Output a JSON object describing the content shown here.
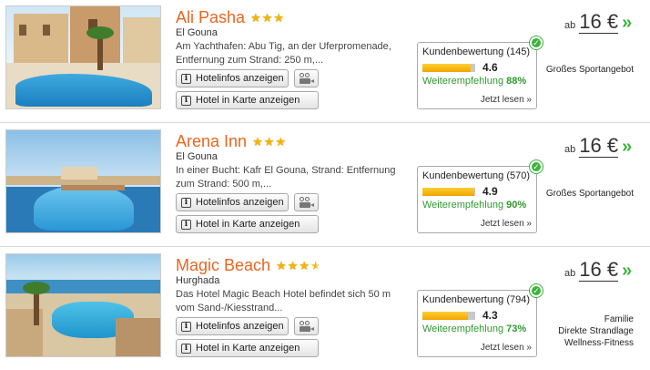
{
  "hotels": [
    {
      "name": "Ali Pasha",
      "stars": 3,
      "location": "El Gouna",
      "description": "Am Yachthafen: Abu Tig, an der Uferpromenade, Entfernung zum Strand: 250 m,...",
      "info_button": "Hotelinfos anzeigen",
      "map_button": "Hotel in Karte anzeigen",
      "rating_label": "Kundenbewertung (145)",
      "score": "4.6",
      "score_fraction": 0.92,
      "recommend_label": "Weiterempfehlung",
      "recommend_pct": "88%",
      "read_label": "Jetzt lesen »",
      "price_prefix": "ab",
      "price": "16 €",
      "go_icon": "»",
      "features": [
        "Großes Sportangebot"
      ]
    },
    {
      "name": "Arena Inn",
      "stars": 3,
      "location": "El Gouna",
      "description": "In einer Bucht: Kafr El Gouna, Strand: Entfernung zum Strand: 500 m,...",
      "info_button": "Hotelinfos anzeigen",
      "map_button": "Hotel in Karte anzeigen",
      "rating_label": "Kundenbewertung (570)",
      "score": "4.9",
      "score_fraction": 0.98,
      "recommend_label": "Weiterempfehlung",
      "recommend_pct": "90%",
      "read_label": "Jetzt lesen »",
      "price_prefix": "ab",
      "price": "16 €",
      "go_icon": "»",
      "features": [
        "Großes Sportangebot"
      ]
    },
    {
      "name": "Magic Beach",
      "stars": 3.5,
      "location": "Hurghada",
      "description": "Das Hotel Magic Beach Hotel befindet sich 50 m vom Sand-/Kiesstrand...",
      "info_button": "Hotelinfos anzeigen",
      "map_button": "Hotel in Karte anzeigen",
      "rating_label": "Kundenbewertung (794)",
      "score": "4.3",
      "score_fraction": 0.86,
      "recommend_label": "Weiterempfehlung",
      "recommend_pct": "73%",
      "read_label": "Jetzt lesen »",
      "price_prefix": "ab",
      "price": "16 €",
      "go_icon": "»",
      "features": [
        "Familie",
        "Direkte Strandlage",
        "Wellness-Fitness"
      ]
    }
  ],
  "colors": {
    "hotel_name": "#e8661f",
    "star": "#f4b400",
    "recommend": "#2f9a2f",
    "go_arrow": "#3cb43c",
    "bar_fill": "#f0a500"
  },
  "icons": {
    "info": "info-icon",
    "video": "video-camera-icon",
    "verified": "check-badge-icon",
    "go": "double-chevron-right-icon"
  }
}
